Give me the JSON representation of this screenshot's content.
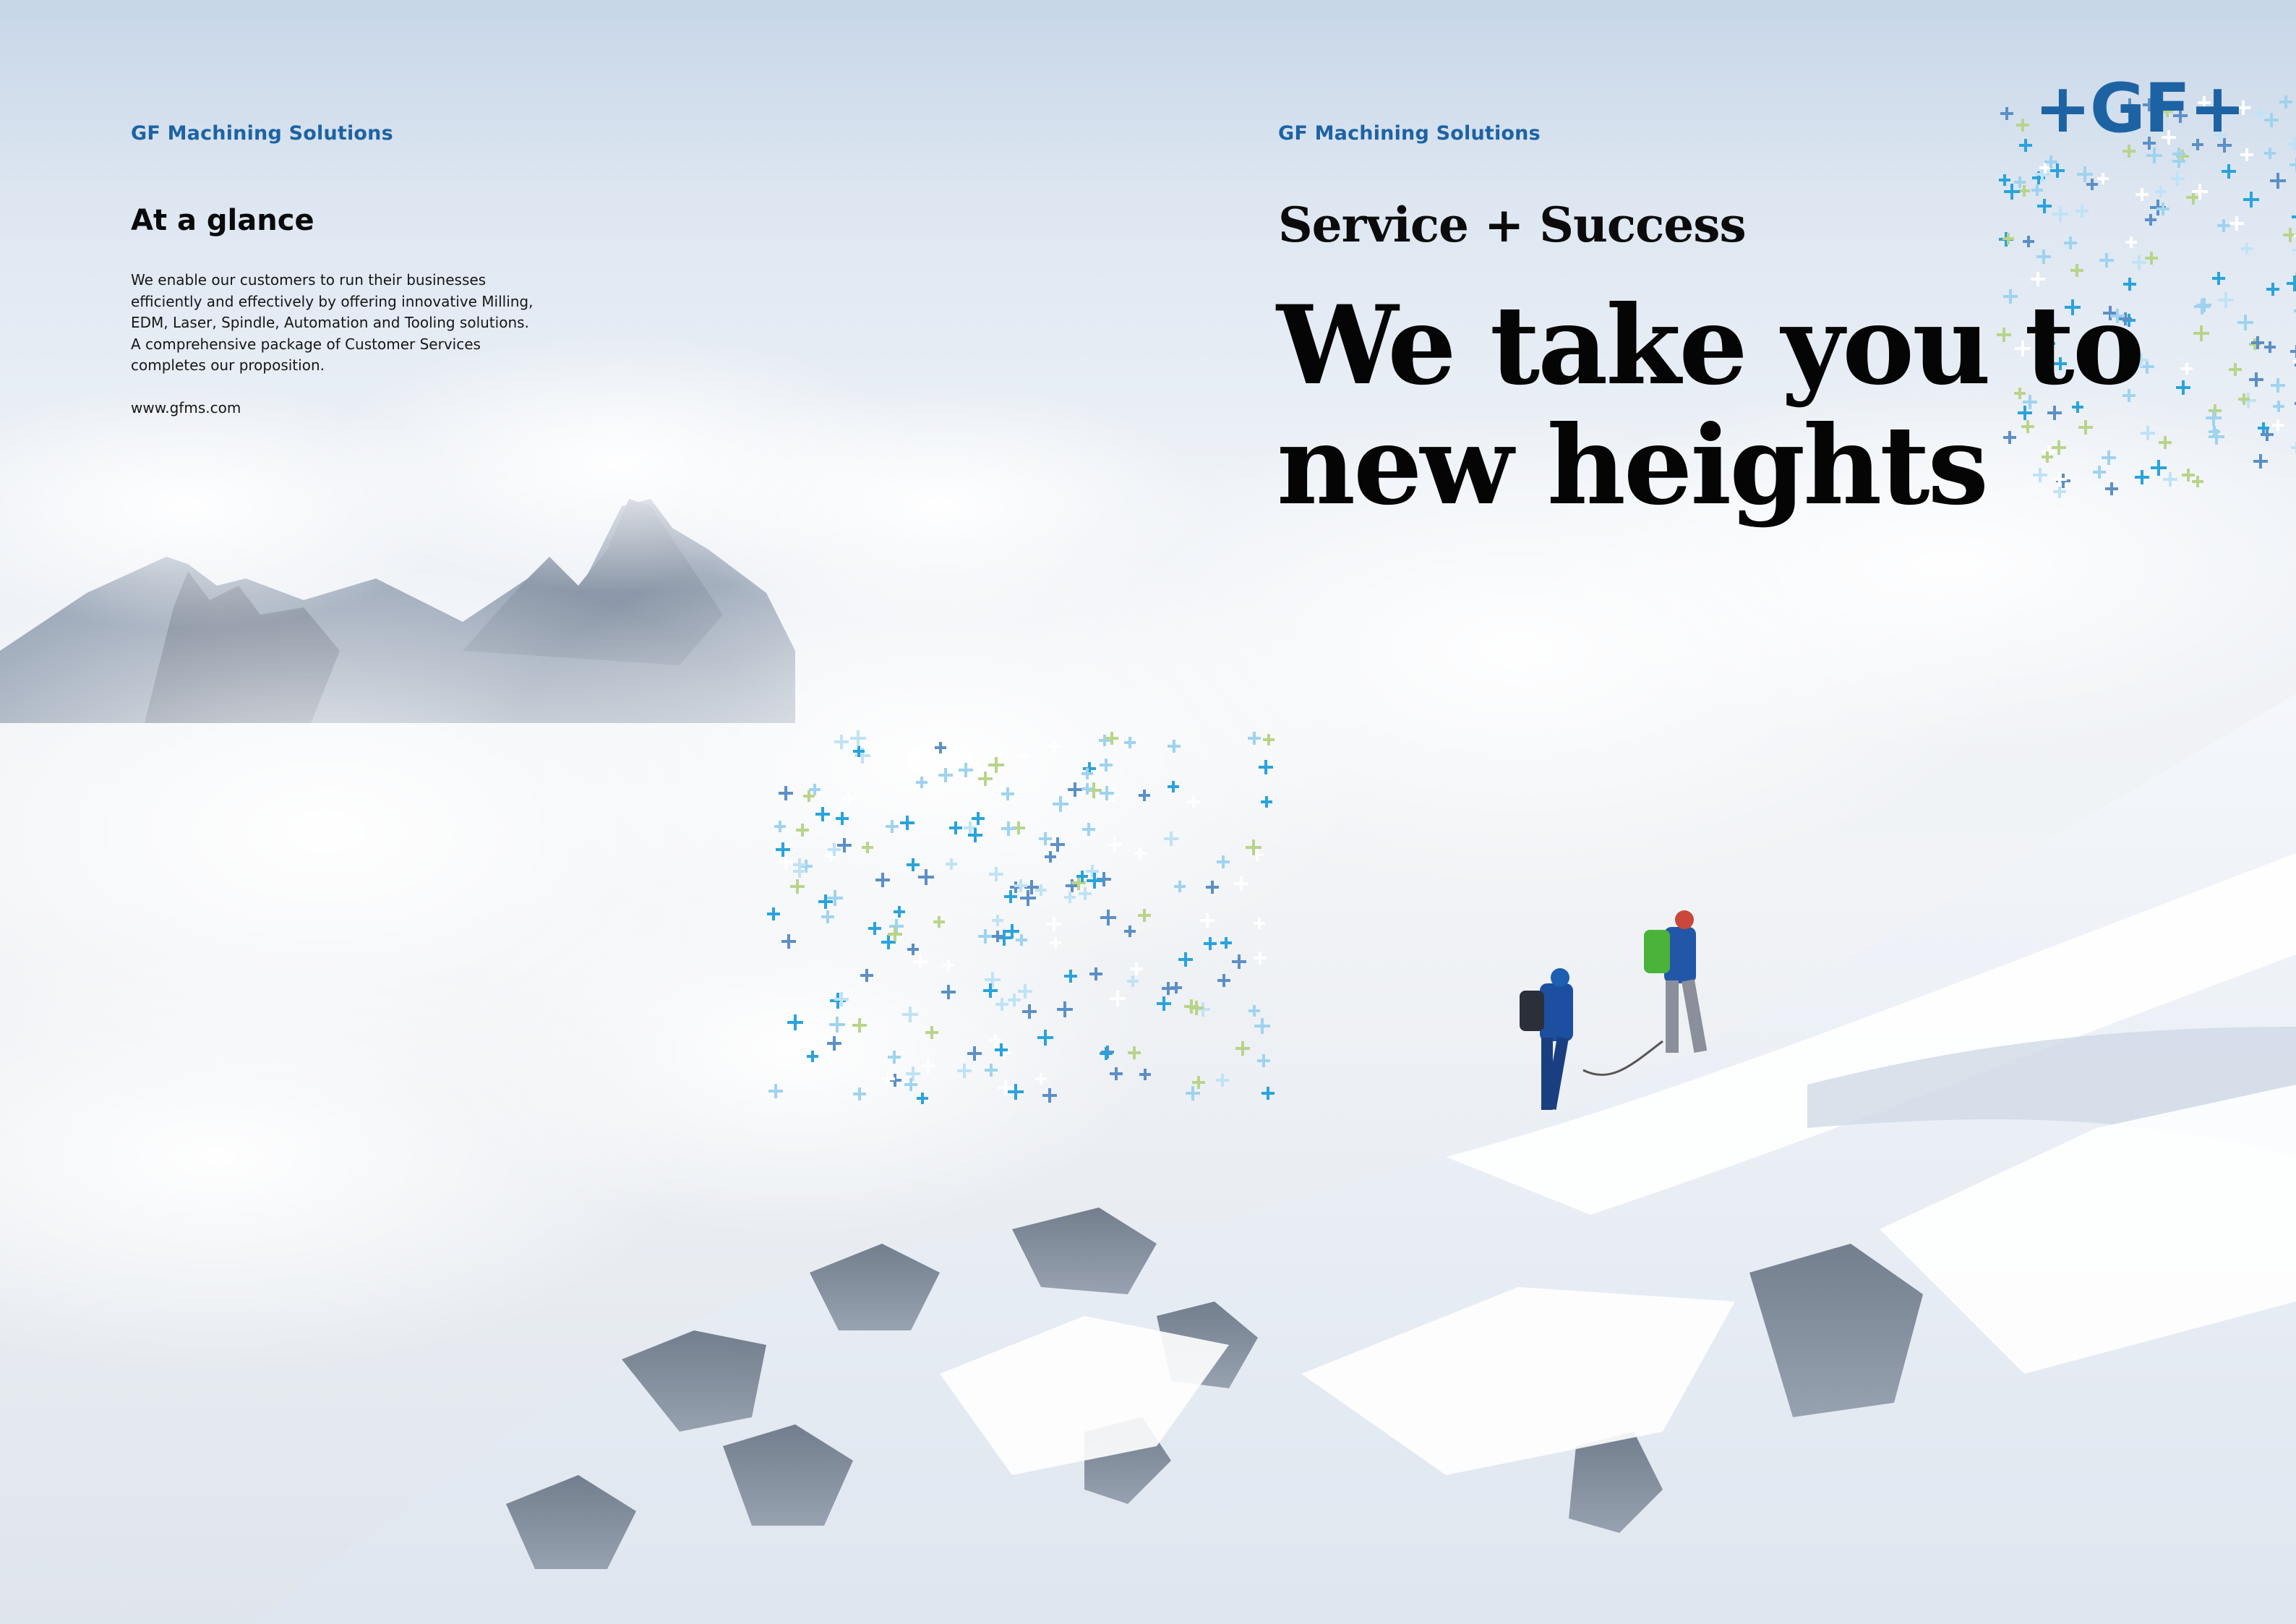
{
  "left_page": {
    "brand": "GF Machining Solutions",
    "title": "At a glance",
    "body_lines": [
      "We enable our customers to run their businesses",
      "efficiently and effectively by offering innovative Milling,",
      "EDM, Laser, Spindle, Automation and Tooling solutions.",
      "A comprehensive package of Customer Services",
      "completes our proposition."
    ],
    "website": "www.gfms.com"
  },
  "right_page": {
    "brand": "GF Machining Solutions",
    "kicker": "Service + Success",
    "headline_line1": "We take you to",
    "headline_line2": "new heights",
    "logo": "+GF+"
  },
  "image": {
    "subject": "two mountaineers on a snowy ridge above clouds",
    "icons": [
      "plus-cross-pattern",
      "climber"
    ]
  },
  "colors": {
    "brand_blue": "#1d63a3",
    "cross_blue": "#2aa3dc",
    "cross_light": "#9fd3ef",
    "cross_green": "#b9d48a"
  }
}
